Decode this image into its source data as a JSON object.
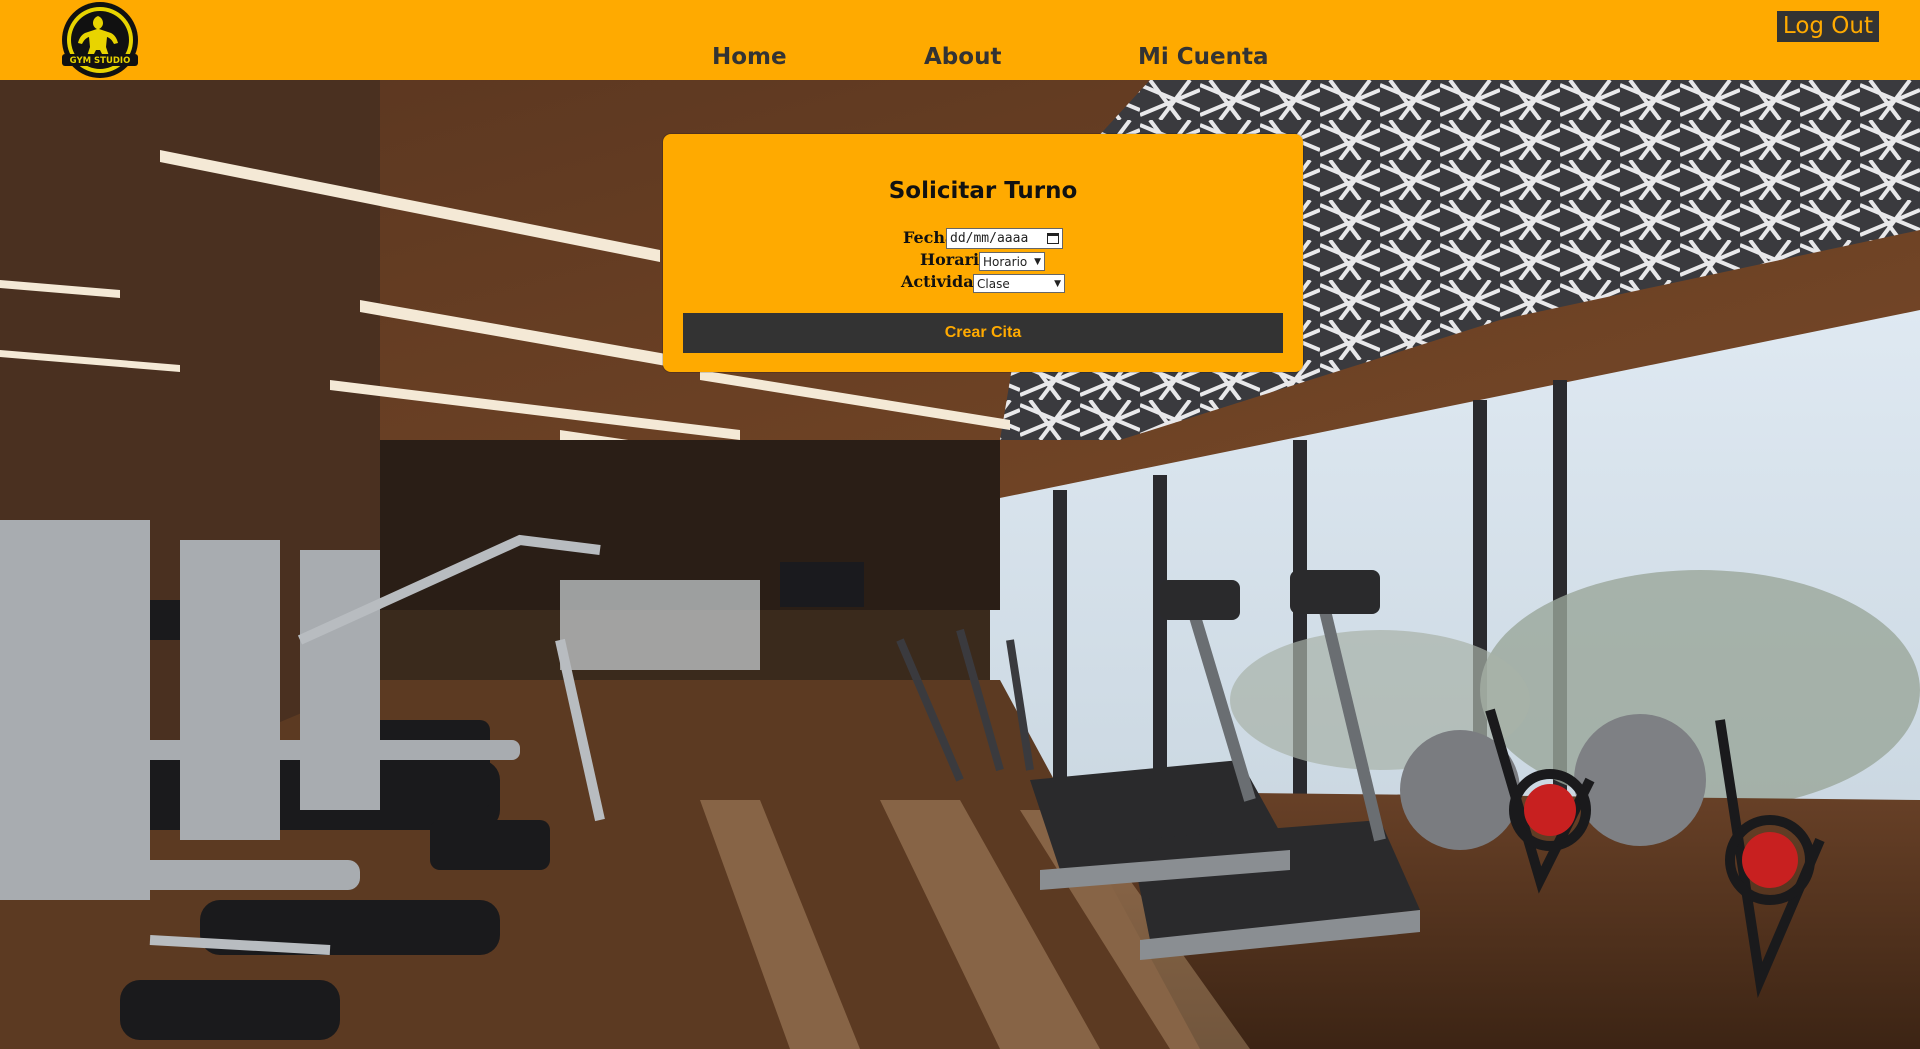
{
  "header": {
    "logo_text": "GYM STUDIO",
    "nav": {
      "home": "Home",
      "about": "About",
      "cuenta": "Mi Cuenta"
    },
    "logout": "Log Out"
  },
  "form": {
    "title": "Solicitar Turno",
    "fecha_label": "Fecha",
    "fecha_placeholder": "dd/mm/aaaa",
    "horario_label": "Horario",
    "horario_value": "Horario",
    "actividad_label": "Actividad",
    "actividad_value": "Clase",
    "submit": "Crear Cita"
  },
  "colors": {
    "accent": "#ffaa00",
    "dark": "#333333"
  },
  "icons": {
    "calendar": "calendar-icon",
    "dropdown": "chevron-down-icon"
  }
}
